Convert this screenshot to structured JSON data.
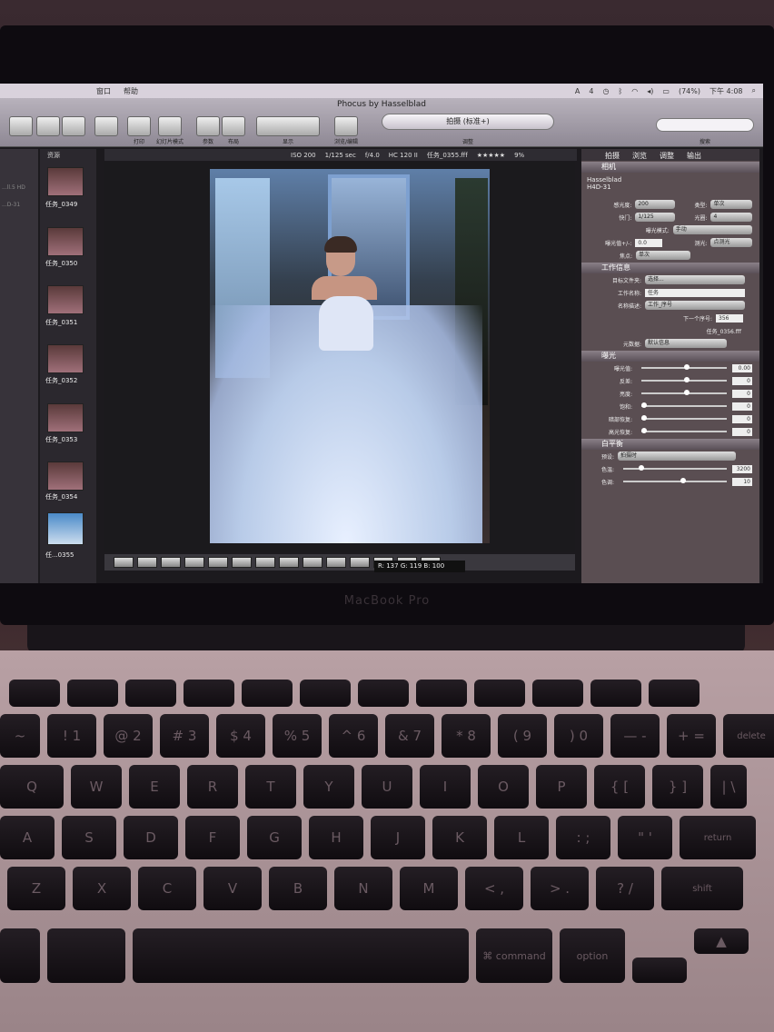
{
  "menubar": {
    "items": [
      "",
      "",
      "",
      "",
      "",
      "",
      "窗口",
      "帮助"
    ],
    "battery": "(74%)",
    "clock": "下午 4:08",
    "input_badge": "4"
  },
  "window": {
    "title": "Phocus by Hasselblad"
  },
  "toolbar": {
    "buttons": [
      "",
      "",
      "",
      "",
      "打印",
      "幻灯片模式",
      "参数",
      "布局",
      "显示",
      "浏览/编辑",
      "调整",
      "搜索"
    ],
    "capture_mode": "拍摄 (标准+)",
    "search_placeholder": ""
  },
  "infobar": {
    "iso": "ISO 200",
    "shutter": "1/125 sec",
    "aperture": "f/4.0",
    "hc": "HC 120 II",
    "filename": "任务_0355.fff",
    "zoom": "9%"
  },
  "browser_header": "资源",
  "left_items": [
    "",
    "",
    "",
    "",
    "",
    "",
    "...ll.5 HD",
    "",
    "...D-31"
  ],
  "thumbnails": [
    "任务_0349",
    "任务_0350",
    "任务_0351",
    "任务_0352",
    "任务_0353",
    "任务_0354",
    "任...0355"
  ],
  "rgb_readout": "R: 137  G: 119  B: 100",
  "panel": {
    "tabs": [
      "拍摄",
      "浏览",
      "调整",
      "输出"
    ],
    "camera_section": "相机",
    "camera_name": "Hasselblad",
    "camera_model": "H4D-31",
    "sensitivity_label": "感光度:",
    "sensitivity": "200",
    "type_label": "类型:",
    "type": "单次",
    "shutter_label": "快门:",
    "shutter": "1/125",
    "aperture_label": "光圈:",
    "aperture": "4",
    "exposure_mode_label": "曝光模式:",
    "exposure_mode": "手动",
    "ev_label": "曝光值+/-:",
    "ev": "0.0",
    "metering_label": "测光:",
    "metering": "点测光",
    "focus_label": "焦点:",
    "focus": "单次",
    "work_section": "工作信息",
    "target_folder_label": "目标文件夹:",
    "target_folder": "选择...",
    "work_name_label": "工作名称:",
    "work_name": "任务",
    "naming_label": "名称描述:",
    "naming": "工作_序号",
    "next_seq_label": "下一个序号:",
    "next_seq": "356",
    "next_file": "任务_0356.fff",
    "metadata_label": "元数据:",
    "metadata": "默认信息",
    "exposure_section": "曝光",
    "exposure_rows": [
      {
        "label": "曝光值:",
        "value": "0.00"
      },
      {
        "label": "反差:",
        "value": "0"
      },
      {
        "label": "亮度:",
        "value": "0"
      },
      {
        "label": "饱和:",
        "value": "0"
      },
      {
        "label": "暗部恢复:",
        "value": "0"
      },
      {
        "label": "高光恢复:",
        "value": "0"
      }
    ],
    "wb_section": "白平衡",
    "wb_preset_label": "预设:",
    "wb_preset": "拍摄时",
    "temp_label": "色温:",
    "temp": "3200",
    "tint_label": "色调:",
    "tint": "10"
  },
  "laptop_label": "MacBook Pro",
  "keyboard": {
    "row1": [
      "~",
      "!\n1",
      "@\n2",
      "#\n3",
      "$\n4",
      "%\n5",
      "^\n6",
      "&\n7",
      "*\n8",
      "(\n9",
      ")\n0",
      "—\n-",
      "+\n=",
      "delete"
    ],
    "row2": [
      "Q",
      "W",
      "E",
      "R",
      "T",
      "Y",
      "U",
      "I",
      "O",
      "P",
      "{\n[",
      "}\n]",
      "|\n\\"
    ],
    "row3": [
      "A",
      "S",
      "D",
      "F",
      "G",
      "H",
      "J",
      "K",
      "L",
      ":\n;",
      "\"\n'",
      "return"
    ],
    "row4": [
      "Z",
      "X",
      "C",
      "V",
      "B",
      "N",
      "M",
      "<\n,",
      ">\n.",
      "?\n/",
      "shift"
    ],
    "row5": [
      "",
      "",
      "",
      "⌘\ncommand",
      "option",
      "",
      "▲"
    ]
  }
}
